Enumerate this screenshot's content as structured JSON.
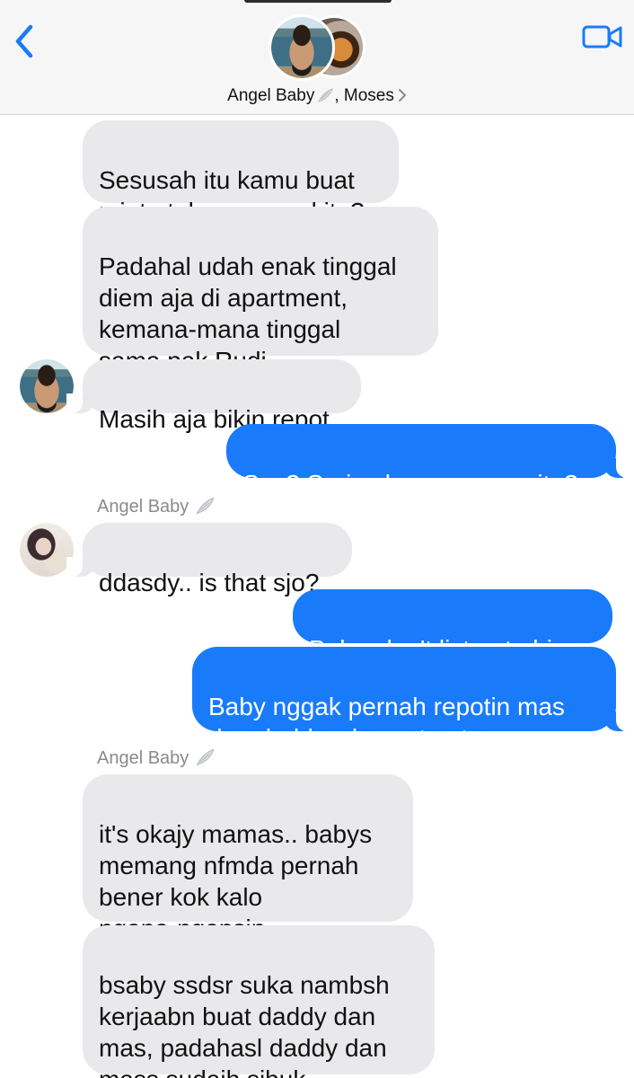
{
  "header": {
    "group_name": "Angel Baby",
    "wing_emoji": "angel-wing-icon",
    "second_member": ", Moses",
    "chevron": "›"
  },
  "messages": [
    {
      "side": "in",
      "text": "Sesusah itu kamu buat\nminta tolong sama kita?"
    },
    {
      "side": "in",
      "text": "Padahal udah enak tinggal\ndiem aja di apartment,\nkemana-mana tinggal\nsama pak Rudi"
    },
    {
      "side": "in",
      "text": "Masih aja bikin repot"
    },
    {
      "side": "out",
      "text": "Ses? Serius lu ngomong gitu?"
    },
    {
      "side": "in",
      "sender": "Angel Baby",
      "text": "ddasdy.. is that sjo?"
    },
    {
      "side": "out",
      "text": "Baby, don't listen to him"
    },
    {
      "side": "out",
      "text": "Baby nggak pernah repotin mas\ndan daddy, please trust me"
    },
    {
      "side": "in",
      "sender": "Angel Baby",
      "text": "it's okajy mamas.. babys\nmemang nfmda pernah\nbener kok kalo\nngapa-ngapsin"
    },
    {
      "side": "in",
      "text": "bsaby ssdsr suka nambsh\nkerjaabn buat daddy dan\nmas, padahasl daddy dan\nmass sudajh sibuk"
    }
  ],
  "colors": {
    "incoming_bubble": "#e9e9eb",
    "outgoing_bubble": "#1a7bfa",
    "accent": "#1a7bfa",
    "sender_label": "#8a8a8e"
  }
}
